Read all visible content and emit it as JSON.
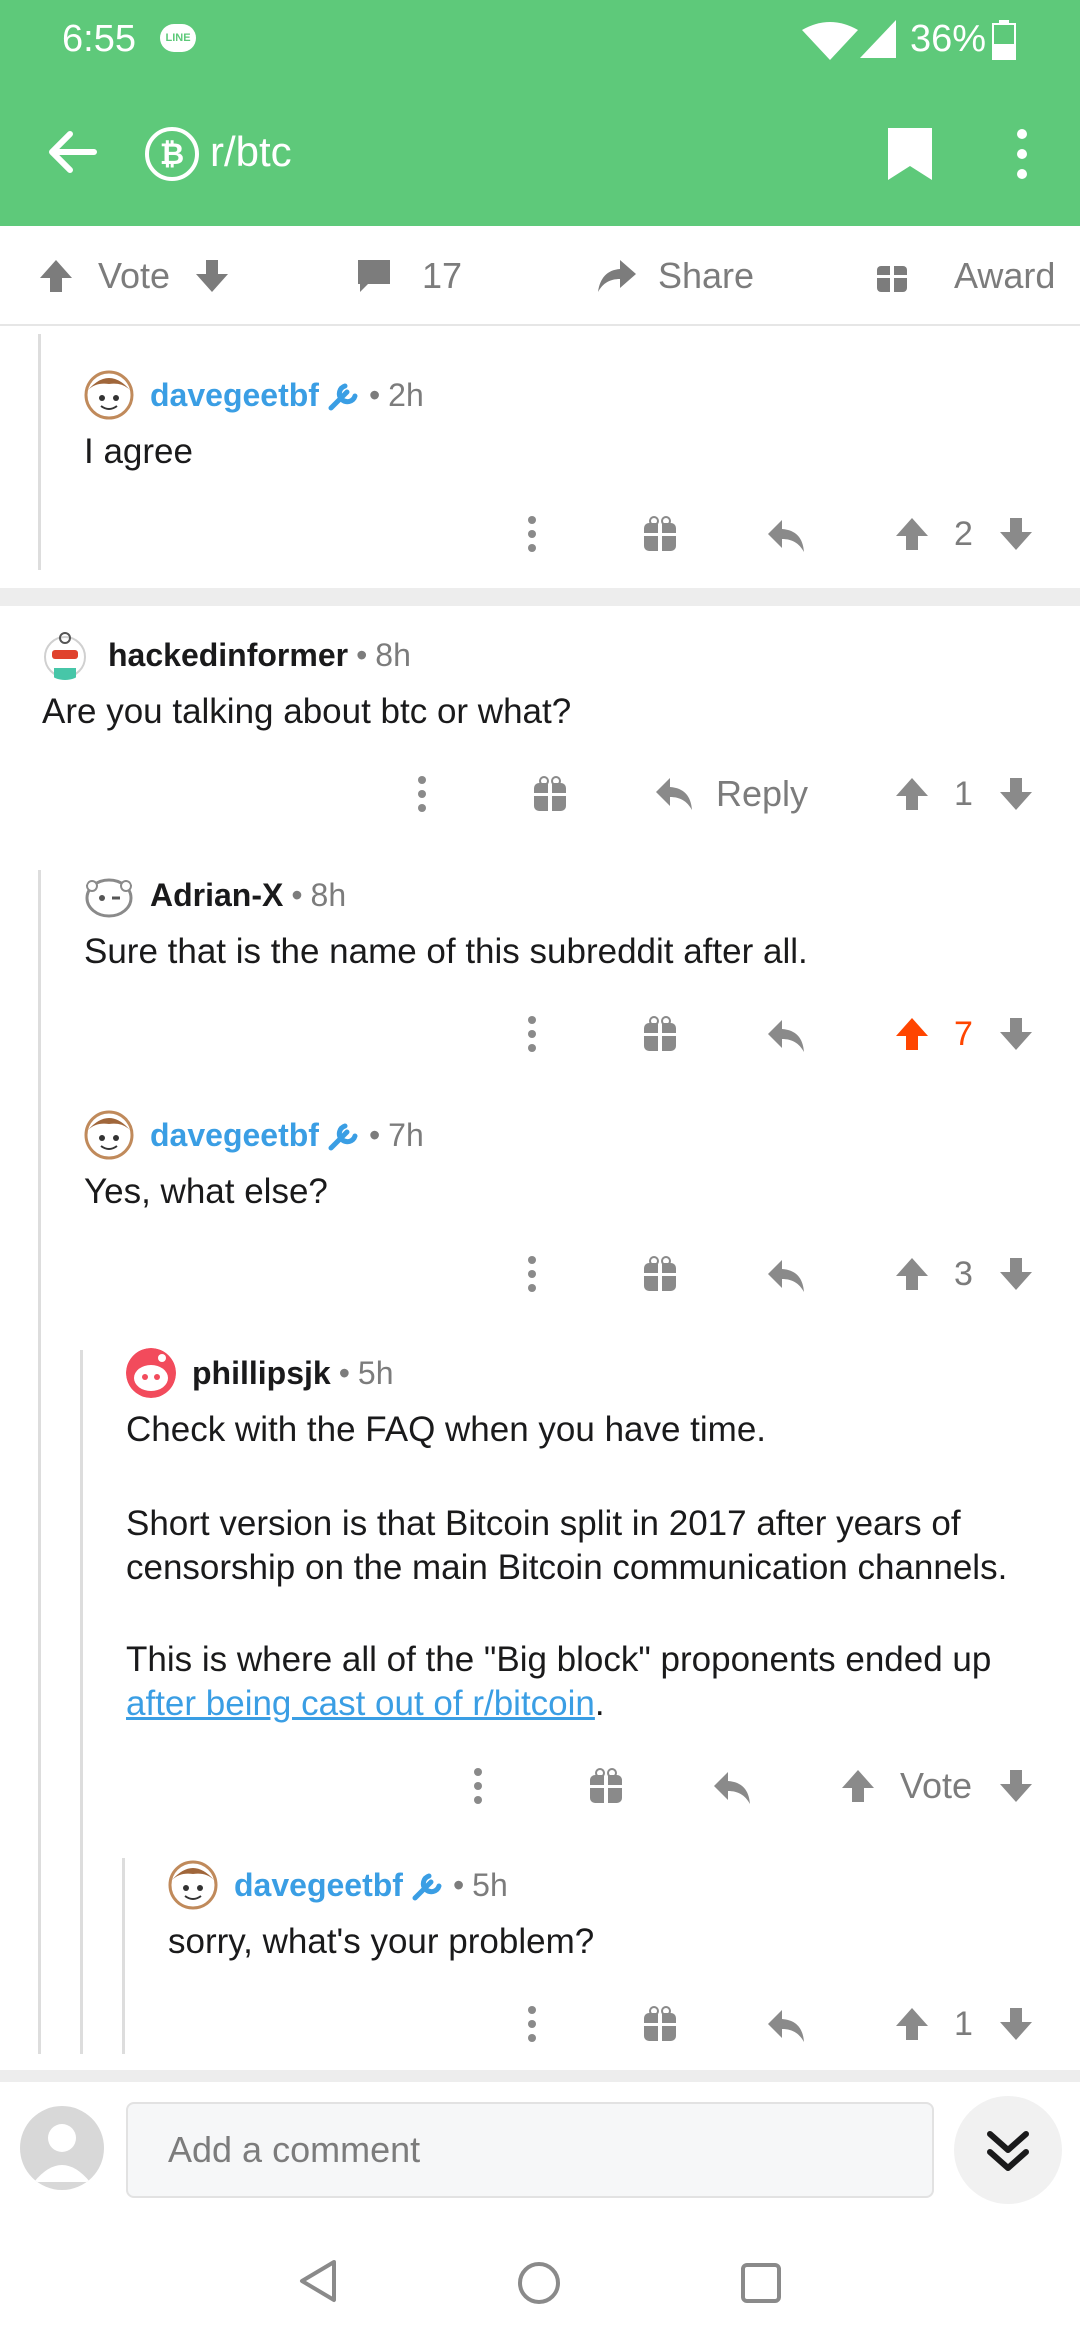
{
  "status_bar": {
    "time": "6:55",
    "battery": "36%",
    "line_badge": "LINE"
  },
  "header": {
    "subreddit": "r/btc"
  },
  "action_bar": {
    "vote_label": "Vote",
    "comment_count": "17",
    "share_label": "Share",
    "award_label": "Award"
  },
  "comments": [
    {
      "author": "davegeetbf",
      "time": "2h",
      "body": "I agree",
      "votes": "2"
    },
    {
      "author": "hackedinformer",
      "time": "8h",
      "body": "Are you talking about btc or what?",
      "reply_label": "Reply",
      "votes": "1"
    },
    {
      "author": "Adrian-X",
      "time": "8h",
      "body": "Sure that is the name of this subreddit after all.",
      "votes": "7"
    },
    {
      "author": "davegeetbf",
      "time": "7h",
      "body": "Yes, what else?",
      "votes": "3"
    },
    {
      "author": "phillipsjk",
      "time": "5h",
      "body_p1": "Check with the FAQ when you have time.",
      "body_p2_l1": "Short version is that Bitcoin split in 2017 after years of",
      "body_p2_l2": "censorship on the main Bitcoin communication channels.",
      "body_p3_l1": "This is where all of the \"Big block\" proponents ended up",
      "body_p3_link": "after being cast out of r/bitcoin",
      "body_p3_end": ".",
      "votes": "Vote"
    },
    {
      "author": "davegeetbf",
      "time": "5h",
      "body": "sorry, what's your problem?",
      "votes": "1"
    }
  ],
  "composer": {
    "placeholder": "Add a comment"
  },
  "colors": {
    "header_green": "#5ec97a",
    "upvote_orange": "#ff4500",
    "mod_blue": "#3a9ee4"
  }
}
